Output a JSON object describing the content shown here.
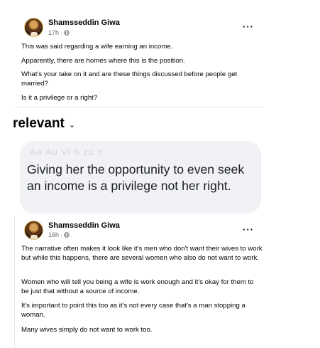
{
  "post1": {
    "author": "Shamsseddin Giwa",
    "time": "17h",
    "meta_separator": "·",
    "more_label": "···",
    "paragraphs": [
      "This was said regarding a wife earning an income.",
      "Apparently, there are homes where this is the position.",
      "What's your take on it and are these things discussed before people get married?",
      "Is it a privilege or a right?"
    ]
  },
  "sort": {
    "label": "relevant",
    "chevron": "⌄"
  },
  "comment": {
    "author_faded": "Aa Au  Vi  h zu n",
    "text": "Giving her the opportunity to even seek an income is a privilege not her right."
  },
  "post2": {
    "author": "Shamsseddin Giwa",
    "time": "16h",
    "meta_separator": "·",
    "more_label": "···",
    "paragraphs": [
      "The narrative often makes it look like it's men who don't want their wives to work but while this happens, there are several women who also do not want to work.",
      "Women who will tell you being a wife is work enough and it's okay for them to be just that without a source of income.",
      "It's important to point this too as it's not every case that's a man stopping a woman.",
      "Many wives simply do not want to work too."
    ]
  },
  "icons": {
    "avatar": "profile-photo",
    "privacy": "globe-icon",
    "more": "more-options-icon",
    "chevron": "chevron-down-icon"
  }
}
